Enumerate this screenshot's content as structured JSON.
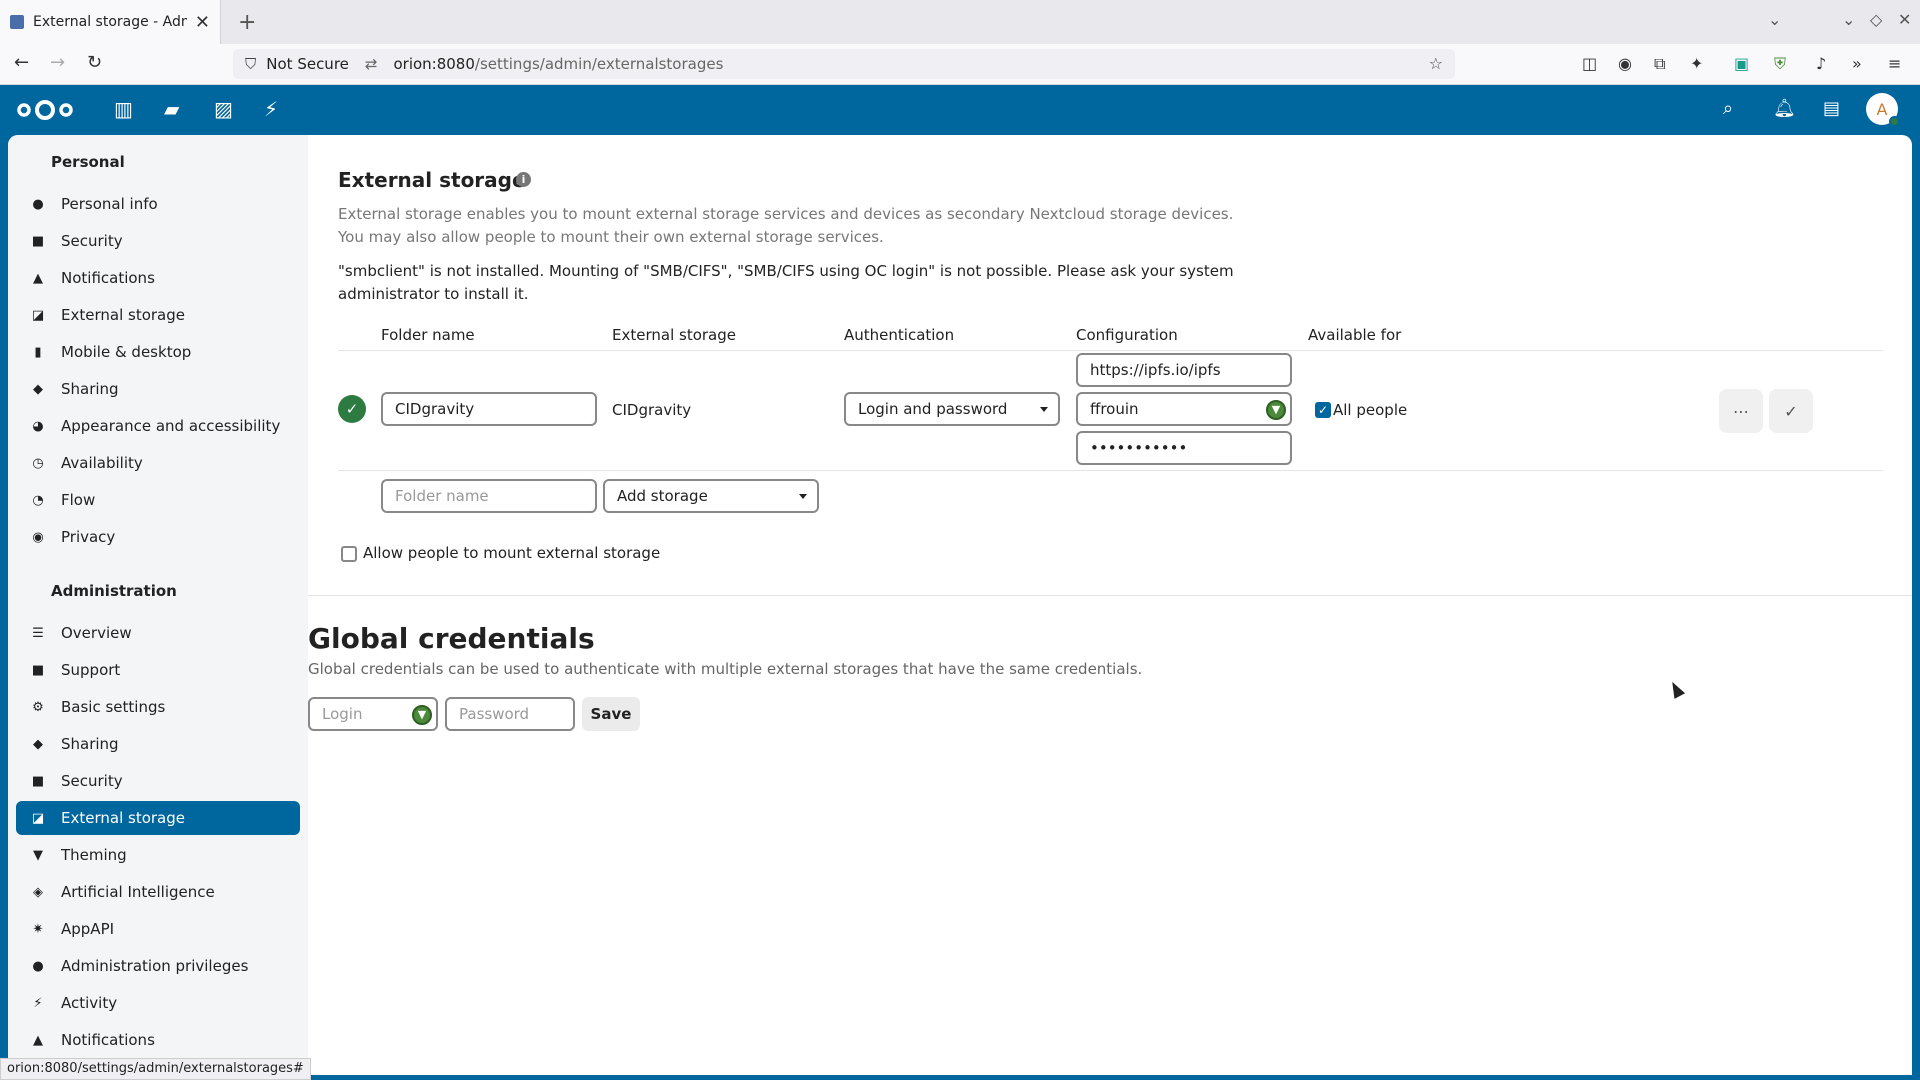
{
  "browser": {
    "tab_title": "External storage - Administ",
    "tab_close": "✕",
    "new_tab": "+",
    "url_security": "Not Secure",
    "url_host": "orion:8080",
    "url_path": "/settings/admin/externalstorages",
    "status_url": "orion:8080/settings/admin/externalstorages#"
  },
  "header": {
    "avatar_letter": "A"
  },
  "sidebar": {
    "personal_title": "Personal",
    "personal_items": [
      {
        "label": "Personal info",
        "icon": "person-icon"
      },
      {
        "label": "Security",
        "icon": "lock-icon"
      },
      {
        "label": "Notifications",
        "icon": "bell-icon"
      },
      {
        "label": "External storage",
        "icon": "external-storage-icon"
      },
      {
        "label": "Mobile & desktop",
        "icon": "phone-icon"
      },
      {
        "label": "Sharing",
        "icon": "share-icon"
      },
      {
        "label": "Appearance and accessibility",
        "icon": "palette-icon"
      },
      {
        "label": "Availability",
        "icon": "clock-icon"
      },
      {
        "label": "Flow",
        "icon": "flow-icon"
      },
      {
        "label": "Privacy",
        "icon": "eye-icon"
      }
    ],
    "admin_title": "Administration",
    "admin_items": [
      {
        "label": "Overview",
        "icon": "tune-icon"
      },
      {
        "label": "Support",
        "icon": "chat-icon"
      },
      {
        "label": "Basic settings",
        "icon": "gear-icon"
      },
      {
        "label": "Sharing",
        "icon": "share-icon"
      },
      {
        "label": "Security",
        "icon": "lock-icon"
      },
      {
        "label": "External storage",
        "icon": "external-storage-icon"
      },
      {
        "label": "Theming",
        "icon": "brush-icon"
      },
      {
        "label": "Artificial Intelligence",
        "icon": "robot-icon"
      },
      {
        "label": "AppAPI",
        "icon": "sparkle-icon"
      },
      {
        "label": "Administration privileges",
        "icon": "admin-icon"
      },
      {
        "label": "Activity",
        "icon": "lightning-icon"
      },
      {
        "label": "Notifications",
        "icon": "bell-icon"
      }
    ]
  },
  "main": {
    "title": "External storage",
    "description": "External storage enables you to mount external storage services and devices as secondary Nextcloud storage devices. You may also allow people to mount their own external storage services.",
    "warning": "\"smbclient\" is not installed. Mounting of \"SMB/CIFS\", \"SMB/CIFS using OC login\" is not possible. Please ask your system administrator to install it.",
    "columns": {
      "folder": "Folder name",
      "storage": "External storage",
      "auth": "Authentication",
      "config": "Configuration",
      "available": "Available for"
    },
    "mount": {
      "folder_value": "CIDgravity",
      "storage_value": "CIDgravity",
      "auth_value": "Login and password",
      "config_url": "https://ipfs.io/ipfs",
      "config_user": "ffrouin",
      "config_password": "•••••••••••",
      "available_label": "All people"
    },
    "new_row": {
      "folder_placeholder": "Folder name",
      "add_storage": "Add storage"
    },
    "allow_mount_label": "Allow people to mount external storage",
    "global": {
      "title": "Global credentials",
      "description": "Global credentials can be used to authenticate with multiple external storages that have the same credentials.",
      "login_placeholder": "Login",
      "password_placeholder": "Password",
      "save_label": "Save"
    }
  }
}
